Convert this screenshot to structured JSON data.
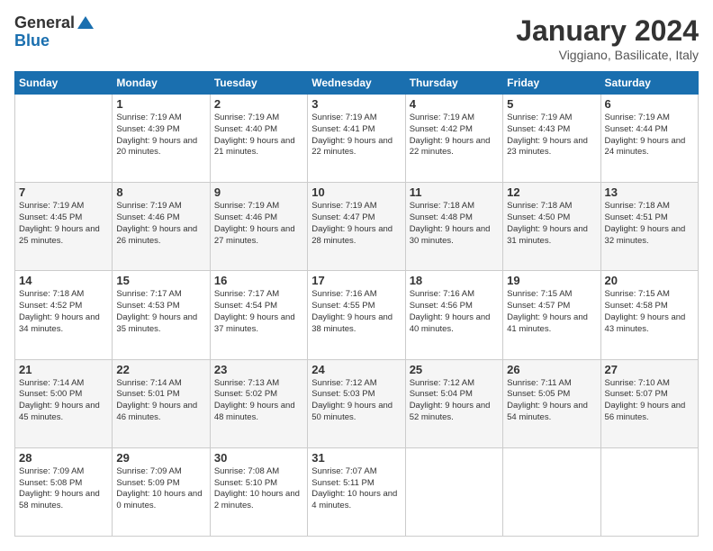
{
  "header": {
    "logo_general": "General",
    "logo_blue": "Blue",
    "month_title": "January 2024",
    "location": "Viggiano, Basilicate, Italy"
  },
  "days_of_week": [
    "Sunday",
    "Monday",
    "Tuesday",
    "Wednesday",
    "Thursday",
    "Friday",
    "Saturday"
  ],
  "weeks": [
    [
      {
        "day": "",
        "sunrise": "",
        "sunset": "",
        "daylight": ""
      },
      {
        "day": "1",
        "sunrise": "Sunrise: 7:19 AM",
        "sunset": "Sunset: 4:39 PM",
        "daylight": "Daylight: 9 hours and 20 minutes."
      },
      {
        "day": "2",
        "sunrise": "Sunrise: 7:19 AM",
        "sunset": "Sunset: 4:40 PM",
        "daylight": "Daylight: 9 hours and 21 minutes."
      },
      {
        "day": "3",
        "sunrise": "Sunrise: 7:19 AM",
        "sunset": "Sunset: 4:41 PM",
        "daylight": "Daylight: 9 hours and 22 minutes."
      },
      {
        "day": "4",
        "sunrise": "Sunrise: 7:19 AM",
        "sunset": "Sunset: 4:42 PM",
        "daylight": "Daylight: 9 hours and 22 minutes."
      },
      {
        "day": "5",
        "sunrise": "Sunrise: 7:19 AM",
        "sunset": "Sunset: 4:43 PM",
        "daylight": "Daylight: 9 hours and 23 minutes."
      },
      {
        "day": "6",
        "sunrise": "Sunrise: 7:19 AM",
        "sunset": "Sunset: 4:44 PM",
        "daylight": "Daylight: 9 hours and 24 minutes."
      }
    ],
    [
      {
        "day": "7",
        "sunrise": "Sunrise: 7:19 AM",
        "sunset": "Sunset: 4:45 PM",
        "daylight": "Daylight: 9 hours and 25 minutes."
      },
      {
        "day": "8",
        "sunrise": "Sunrise: 7:19 AM",
        "sunset": "Sunset: 4:46 PM",
        "daylight": "Daylight: 9 hours and 26 minutes."
      },
      {
        "day": "9",
        "sunrise": "Sunrise: 7:19 AM",
        "sunset": "Sunset: 4:46 PM",
        "daylight": "Daylight: 9 hours and 27 minutes."
      },
      {
        "day": "10",
        "sunrise": "Sunrise: 7:19 AM",
        "sunset": "Sunset: 4:47 PM",
        "daylight": "Daylight: 9 hours and 28 minutes."
      },
      {
        "day": "11",
        "sunrise": "Sunrise: 7:18 AM",
        "sunset": "Sunset: 4:48 PM",
        "daylight": "Daylight: 9 hours and 30 minutes."
      },
      {
        "day": "12",
        "sunrise": "Sunrise: 7:18 AM",
        "sunset": "Sunset: 4:50 PM",
        "daylight": "Daylight: 9 hours and 31 minutes."
      },
      {
        "day": "13",
        "sunrise": "Sunrise: 7:18 AM",
        "sunset": "Sunset: 4:51 PM",
        "daylight": "Daylight: 9 hours and 32 minutes."
      }
    ],
    [
      {
        "day": "14",
        "sunrise": "Sunrise: 7:18 AM",
        "sunset": "Sunset: 4:52 PM",
        "daylight": "Daylight: 9 hours and 34 minutes."
      },
      {
        "day": "15",
        "sunrise": "Sunrise: 7:17 AM",
        "sunset": "Sunset: 4:53 PM",
        "daylight": "Daylight: 9 hours and 35 minutes."
      },
      {
        "day": "16",
        "sunrise": "Sunrise: 7:17 AM",
        "sunset": "Sunset: 4:54 PM",
        "daylight": "Daylight: 9 hours and 37 minutes."
      },
      {
        "day": "17",
        "sunrise": "Sunrise: 7:16 AM",
        "sunset": "Sunset: 4:55 PM",
        "daylight": "Daylight: 9 hours and 38 minutes."
      },
      {
        "day": "18",
        "sunrise": "Sunrise: 7:16 AM",
        "sunset": "Sunset: 4:56 PM",
        "daylight": "Daylight: 9 hours and 40 minutes."
      },
      {
        "day": "19",
        "sunrise": "Sunrise: 7:15 AM",
        "sunset": "Sunset: 4:57 PM",
        "daylight": "Daylight: 9 hours and 41 minutes."
      },
      {
        "day": "20",
        "sunrise": "Sunrise: 7:15 AM",
        "sunset": "Sunset: 4:58 PM",
        "daylight": "Daylight: 9 hours and 43 minutes."
      }
    ],
    [
      {
        "day": "21",
        "sunrise": "Sunrise: 7:14 AM",
        "sunset": "Sunset: 5:00 PM",
        "daylight": "Daylight: 9 hours and 45 minutes."
      },
      {
        "day": "22",
        "sunrise": "Sunrise: 7:14 AM",
        "sunset": "Sunset: 5:01 PM",
        "daylight": "Daylight: 9 hours and 46 minutes."
      },
      {
        "day": "23",
        "sunrise": "Sunrise: 7:13 AM",
        "sunset": "Sunset: 5:02 PM",
        "daylight": "Daylight: 9 hours and 48 minutes."
      },
      {
        "day": "24",
        "sunrise": "Sunrise: 7:12 AM",
        "sunset": "Sunset: 5:03 PM",
        "daylight": "Daylight: 9 hours and 50 minutes."
      },
      {
        "day": "25",
        "sunrise": "Sunrise: 7:12 AM",
        "sunset": "Sunset: 5:04 PM",
        "daylight": "Daylight: 9 hours and 52 minutes."
      },
      {
        "day": "26",
        "sunrise": "Sunrise: 7:11 AM",
        "sunset": "Sunset: 5:05 PM",
        "daylight": "Daylight: 9 hours and 54 minutes."
      },
      {
        "day": "27",
        "sunrise": "Sunrise: 7:10 AM",
        "sunset": "Sunset: 5:07 PM",
        "daylight": "Daylight: 9 hours and 56 minutes."
      }
    ],
    [
      {
        "day": "28",
        "sunrise": "Sunrise: 7:09 AM",
        "sunset": "Sunset: 5:08 PM",
        "daylight": "Daylight: 9 hours and 58 minutes."
      },
      {
        "day": "29",
        "sunrise": "Sunrise: 7:09 AM",
        "sunset": "Sunset: 5:09 PM",
        "daylight": "Daylight: 10 hours and 0 minutes."
      },
      {
        "day": "30",
        "sunrise": "Sunrise: 7:08 AM",
        "sunset": "Sunset: 5:10 PM",
        "daylight": "Daylight: 10 hours and 2 minutes."
      },
      {
        "day": "31",
        "sunrise": "Sunrise: 7:07 AM",
        "sunset": "Sunset: 5:11 PM",
        "daylight": "Daylight: 10 hours and 4 minutes."
      },
      {
        "day": "",
        "sunrise": "",
        "sunset": "",
        "daylight": ""
      },
      {
        "day": "",
        "sunrise": "",
        "sunset": "",
        "daylight": ""
      },
      {
        "day": "",
        "sunrise": "",
        "sunset": "",
        "daylight": ""
      }
    ]
  ]
}
